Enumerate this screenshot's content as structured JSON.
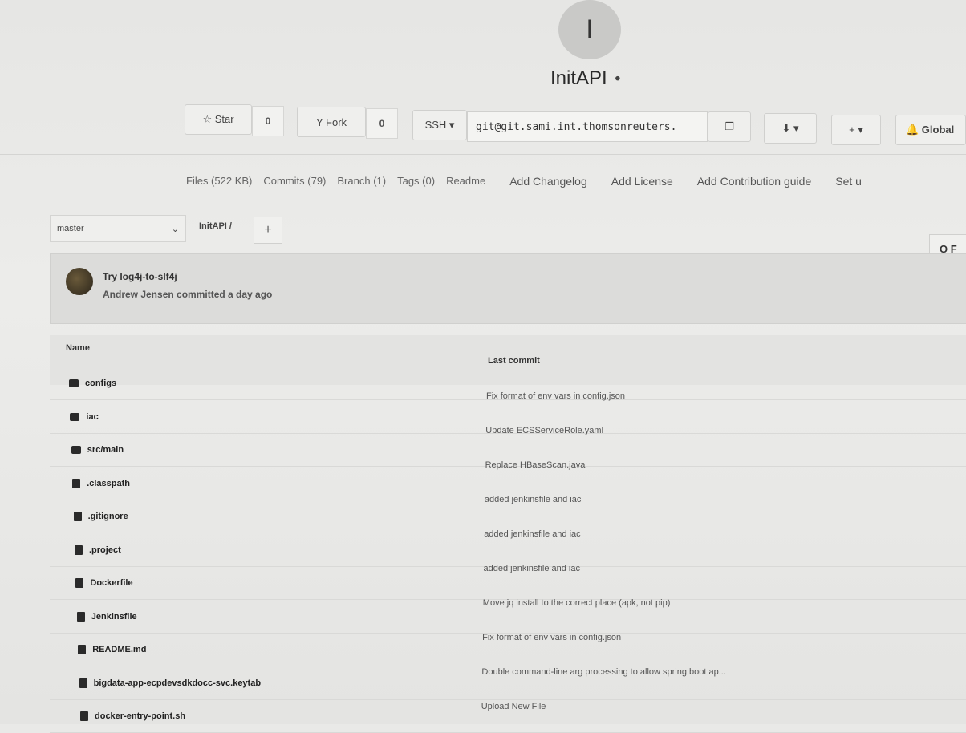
{
  "project": {
    "avatar_letter": "I",
    "name": "InitAPI",
    "visibility_icon": "lock-icon"
  },
  "actions": {
    "star_label": "☆ Star",
    "star_count": "0",
    "fork_label": "Y Fork",
    "fork_count": "0",
    "protocol": "SSH ▾",
    "clone_url": "git@git.sami.int.thomsonreuters.",
    "download": "⬇ ▾",
    "add": "+ ▾",
    "notification": "🔔 Global"
  },
  "nav": {
    "files": "Files (522 KB)",
    "commits": "Commits (79)",
    "branch": "Branch (1)",
    "tags": "Tags (0)",
    "readme": "Readme",
    "changelog": "Add Changelog",
    "license": "Add License",
    "contribution": "Add Contribution guide",
    "set": "Set u"
  },
  "tree": {
    "branch": "master",
    "path": "InitAPI /",
    "add": "+",
    "find": "Q F"
  },
  "last_commit": {
    "title": "Try log4j-to-slf4j",
    "author_line": "Andrew Jensen committed a day ago"
  },
  "table": {
    "col_name": "Name",
    "col_last_commit": "Last commit",
    "rows": [
      {
        "name": "configs",
        "type": "folder",
        "commit": "Fix format of env vars in config.json"
      },
      {
        "name": "iac",
        "type": "folder",
        "commit": "Update ECSServiceRole.yaml"
      },
      {
        "name": "src/main",
        "type": "folder",
        "commit": "Replace HBaseScan.java"
      },
      {
        "name": ".classpath",
        "type": "file",
        "commit": "added jenkinsfile and iac"
      },
      {
        "name": ".gitignore",
        "type": "file",
        "commit": "added jenkinsfile and iac"
      },
      {
        "name": ".project",
        "type": "file",
        "commit": "added jenkinsfile and iac"
      },
      {
        "name": "Dockerfile",
        "type": "file",
        "commit": "Move jq install to the correct place (apk, not pip)"
      },
      {
        "name": "Jenkinsfile",
        "type": "file",
        "commit": "Fix format of env vars in config.json"
      },
      {
        "name": "README.md",
        "type": "file",
        "commit": "Double command-line arg processing to allow spring boot ap..."
      },
      {
        "name": "bigdata-app-ecpdevsdkdocc-svc.keytab",
        "type": "file",
        "commit": "Upload New File"
      },
      {
        "name": "docker-entry-point.sh",
        "type": "file",
        "commit": ""
      }
    ]
  }
}
